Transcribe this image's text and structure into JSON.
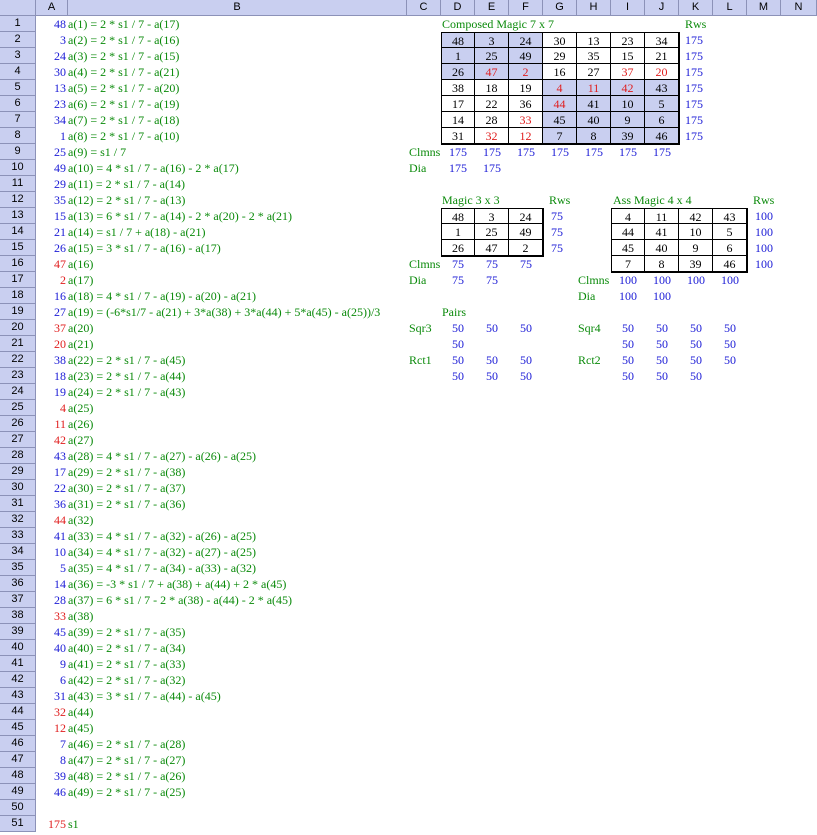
{
  "columns": [
    "A",
    "B",
    "C",
    "D",
    "E",
    "F",
    "G",
    "H",
    "I",
    "J",
    "K",
    "L",
    "M",
    "N"
  ],
  "rows": [
    "1",
    "2",
    "3",
    "4",
    "5",
    "6",
    "7",
    "8",
    "9",
    "10",
    "11",
    "12",
    "13",
    "14",
    "15",
    "16",
    "17",
    "18",
    "19",
    "20",
    "21",
    "22",
    "23",
    "24",
    "25",
    "26",
    "27",
    "28",
    "29",
    "30",
    "31",
    "32",
    "33",
    "34",
    "35",
    "36",
    "37",
    "38",
    "39",
    "40",
    "41",
    "42",
    "43",
    "44",
    "45",
    "46",
    "47",
    "48",
    "49",
    "50",
    "51"
  ],
  "colA": [
    {
      "v": "48",
      "c": "blue"
    },
    {
      "v": "3",
      "c": "blue"
    },
    {
      "v": "24",
      "c": "blue"
    },
    {
      "v": "30",
      "c": "blue"
    },
    {
      "v": "13",
      "c": "blue"
    },
    {
      "v": "23",
      "c": "blue"
    },
    {
      "v": "34",
      "c": "blue"
    },
    {
      "v": "1",
      "c": "blue"
    },
    {
      "v": "25",
      "c": "blue"
    },
    {
      "v": "49",
      "c": "blue"
    },
    {
      "v": "29",
      "c": "blue"
    },
    {
      "v": "35",
      "c": "blue"
    },
    {
      "v": "15",
      "c": "blue"
    },
    {
      "v": "21",
      "c": "blue"
    },
    {
      "v": "26",
      "c": "blue"
    },
    {
      "v": "47",
      "c": "red"
    },
    {
      "v": "2",
      "c": "red"
    },
    {
      "v": "16",
      "c": "blue"
    },
    {
      "v": "27",
      "c": "blue"
    },
    {
      "v": "37",
      "c": "red"
    },
    {
      "v": "20",
      "c": "red"
    },
    {
      "v": "38",
      "c": "blue"
    },
    {
      "v": "18",
      "c": "blue"
    },
    {
      "v": "19",
      "c": "blue"
    },
    {
      "v": "4",
      "c": "red"
    },
    {
      "v": "11",
      "c": "red"
    },
    {
      "v": "42",
      "c": "red"
    },
    {
      "v": "43",
      "c": "blue"
    },
    {
      "v": "17",
      "c": "blue"
    },
    {
      "v": "22",
      "c": "blue"
    },
    {
      "v": "36",
      "c": "blue"
    },
    {
      "v": "44",
      "c": "red"
    },
    {
      "v": "41",
      "c": "blue"
    },
    {
      "v": "10",
      "c": "blue"
    },
    {
      "v": "5",
      "c": "blue"
    },
    {
      "v": "14",
      "c": "blue"
    },
    {
      "v": "28",
      "c": "blue"
    },
    {
      "v": "33",
      "c": "red"
    },
    {
      "v": "45",
      "c": "blue"
    },
    {
      "v": "40",
      "c": "blue"
    },
    {
      "v": "9",
      "c": "blue"
    },
    {
      "v": "6",
      "c": "blue"
    },
    {
      "v": "31",
      "c": "blue"
    },
    {
      "v": "32",
      "c": "red"
    },
    {
      "v": "12",
      "c": "red"
    },
    {
      "v": "7",
      "c": "blue"
    },
    {
      "v": "8",
      "c": "blue"
    },
    {
      "v": "39",
      "c": "blue"
    },
    {
      "v": "46",
      "c": "blue"
    },
    {
      "v": "",
      "c": "blue"
    },
    {
      "v": "175",
      "c": "red"
    }
  ],
  "colB": [
    "a(1) = 2 * s1 / 7 - a(17)",
    "a(2) = 2 * s1 / 7 - a(16)",
    "a(3) = 2 * s1 / 7 - a(15)",
    "a(4) = 2 * s1 / 7 - a(21)",
    "a(5) = 2 * s1 / 7 - a(20)",
    "a(6) = 2 * s1 / 7 - a(19)",
    "a(7) = 2 * s1 / 7 - a(18)",
    "a(8) = 2 * s1 / 7 - a(10)",
    "a(9) = s1 / 7",
    "a(10) = 4 * s1 / 7 - a(16) - 2 * a(17)",
    "a(11) = 2 * s1 / 7 - a(14)",
    "a(12) = 2 * s1 / 7 - a(13)",
    "a(13) = 6 * s1 / 7 - a(14) - 2 * a(20) - 2 * a(21)",
    "a(14) = s1 / 7 + a(18) - a(21)",
    "a(15) = 3 * s1 / 7 - a(16) - a(17)",
    "a(16)",
    "a(17)",
    "a(18) = 4 * s1 / 7 - a(19) - a(20) - a(21)",
    "a(19) = (-6*s1/7 - a(21) + 3*a(38) + 3*a(44) + 5*a(45) - a(25))/3",
    "a(20)",
    "a(21)",
    "a(22) = 2 * s1 / 7 - a(45)",
    "a(23) = 2 * s1 / 7 - a(44)",
    "a(24) = 2 * s1 / 7 - a(43)",
    "a(25)",
    "a(26)",
    "a(27)",
    "a(28) = 4 * s1 / 7 - a(27) - a(26) - a(25)",
    "a(29) = 2 * s1 / 7 - a(38)",
    "a(30) = 2 * s1 / 7 - a(37)",
    "a(31) = 2 * s1 / 7 - a(36)",
    "a(32)",
    "a(33) = 4 * s1 / 7 - a(32) - a(26) - a(25)",
    "a(34) = 4 * s1 / 7 - a(32) - a(27) - a(25)",
    "a(35) = 4 * s1 / 7 - a(34) - a(33) - a(32)",
    "a(36) = -3 * s1 / 7 + a(38) + a(44) + 2 * a(45)",
    "a(37) = 6 * s1 / 7 - 2 * a(38) - a(44) - 2 * a(45)",
    "a(38)",
    "a(39) = 2 * s1 / 7 - a(35)",
    "a(40) = 2 * s1 / 7 - a(34)",
    "a(41) = 2 * s1 / 7 - a(33)",
    "a(42) = 2 * s1 / 7 - a(32)",
    "a(43) = 3 * s1 / 7 - a(44) - a(45)",
    "a(44)",
    "a(45)",
    "a(46) = 2 * s1 / 7 - a(28)",
    "a(47) = 2 * s1 / 7 - a(27)",
    "a(48) = 2 * s1 / 7 - a(26)",
    "a(49) = 2 * s1 / 7 - a(25)",
    "",
    "s1"
  ],
  "magic7": {
    "title": "Composed Magic 7 x 7",
    "rws_label": "Rws",
    "grid": [
      [
        {
          "v": "48",
          "c": "blk",
          "s": 1
        },
        {
          "v": "3",
          "c": "blk",
          "s": 1
        },
        {
          "v": "24",
          "c": "blk",
          "s": 1
        },
        {
          "v": "30",
          "c": "blk",
          "s": 0
        },
        {
          "v": "13",
          "c": "blk",
          "s": 0
        },
        {
          "v": "23",
          "c": "blk",
          "s": 0
        },
        {
          "v": "34",
          "c": "blk",
          "s": 0
        }
      ],
      [
        {
          "v": "1",
          "c": "blk",
          "s": 1
        },
        {
          "v": "25",
          "c": "blk",
          "s": 1
        },
        {
          "v": "49",
          "c": "blk",
          "s": 1
        },
        {
          "v": "29",
          "c": "blk",
          "s": 0
        },
        {
          "v": "35",
          "c": "blk",
          "s": 0
        },
        {
          "v": "15",
          "c": "blk",
          "s": 0
        },
        {
          "v": "21",
          "c": "blk",
          "s": 0
        }
      ],
      [
        {
          "v": "26",
          "c": "blk",
          "s": 1
        },
        {
          "v": "47",
          "c": "red",
          "s": 1
        },
        {
          "v": "2",
          "c": "red",
          "s": 1
        },
        {
          "v": "16",
          "c": "blk",
          "s": 0
        },
        {
          "v": "27",
          "c": "blk",
          "s": 0
        },
        {
          "v": "37",
          "c": "red",
          "s": 0
        },
        {
          "v": "20",
          "c": "red",
          "s": 0
        }
      ],
      [
        {
          "v": "38",
          "c": "blk",
          "s": 0
        },
        {
          "v": "18",
          "c": "blk",
          "s": 0
        },
        {
          "v": "19",
          "c": "blk",
          "s": 0
        },
        {
          "v": "4",
          "c": "red",
          "s": 1
        },
        {
          "v": "11",
          "c": "red",
          "s": 1
        },
        {
          "v": "42",
          "c": "red",
          "s": 1
        },
        {
          "v": "43",
          "c": "blk",
          "s": 1
        }
      ],
      [
        {
          "v": "17",
          "c": "blk",
          "s": 0
        },
        {
          "v": "22",
          "c": "blk",
          "s": 0
        },
        {
          "v": "36",
          "c": "blk",
          "s": 0
        },
        {
          "v": "44",
          "c": "red",
          "s": 1
        },
        {
          "v": "41",
          "c": "blk",
          "s": 1
        },
        {
          "v": "10",
          "c": "blk",
          "s": 1
        },
        {
          "v": "5",
          "c": "blk",
          "s": 1
        }
      ],
      [
        {
          "v": "14",
          "c": "blk",
          "s": 0
        },
        {
          "v": "28",
          "c": "blk",
          "s": 0
        },
        {
          "v": "33",
          "c": "red",
          "s": 0
        },
        {
          "v": "45",
          "c": "blk",
          "s": 1
        },
        {
          "v": "40",
          "c": "blk",
          "s": 1
        },
        {
          "v": "9",
          "c": "blk",
          "s": 1
        },
        {
          "v": "6",
          "c": "blk",
          "s": 1
        }
      ],
      [
        {
          "v": "31",
          "c": "blk",
          "s": 0
        },
        {
          "v": "32",
          "c": "red",
          "s": 0
        },
        {
          "v": "12",
          "c": "red",
          "s": 0
        },
        {
          "v": "7",
          "c": "blk",
          "s": 1
        },
        {
          "v": "8",
          "c": "blk",
          "s": 1
        },
        {
          "v": "39",
          "c": "blk",
          "s": 1
        },
        {
          "v": "46",
          "c": "blk",
          "s": 1
        }
      ]
    ],
    "rws": [
      "175",
      "175",
      "175",
      "175",
      "175",
      "175",
      "175"
    ],
    "clmns_label": "Clmns",
    "clmns": [
      "175",
      "175",
      "175",
      "175",
      "175",
      "175",
      "175"
    ],
    "dia_label": "Dia",
    "dia": [
      "175",
      "175"
    ]
  },
  "magic3": {
    "title": "Magic 3 x 3",
    "rws_label": "Rws",
    "grid": [
      [
        "48",
        "3",
        "24"
      ],
      [
        "1",
        "25",
        "49"
      ],
      [
        "26",
        "47",
        "2"
      ]
    ],
    "rws": [
      "75",
      "75",
      "75"
    ],
    "clmns_label": "Clmns",
    "clmns": [
      "75",
      "75",
      "75"
    ],
    "dia_label": "Dia",
    "dia": [
      "75",
      "75"
    ]
  },
  "magic4": {
    "title": "Ass Magic 4 x 4",
    "rws_label": "Rws",
    "grid": [
      [
        "4",
        "11",
        "42",
        "43"
      ],
      [
        "44",
        "41",
        "10",
        "5"
      ],
      [
        "45",
        "40",
        "9",
        "6"
      ],
      [
        "7",
        "8",
        "39",
        "46"
      ]
    ],
    "rws": [
      "100",
      "100",
      "100",
      "100"
    ],
    "clmns_label": "Clmns",
    "clmns": [
      "100",
      "100",
      "100",
      "100"
    ],
    "dia_label": "Dia",
    "dia": [
      "100",
      "100"
    ]
  },
  "pairs": {
    "title": "Pairs",
    "sqr3_label": "Sqr3",
    "sqr3": [
      [
        "50",
        "50",
        "50"
      ],
      [
        "50",
        "",
        ""
      ]
    ],
    "rct1_label": "Rct1",
    "rct1": [
      [
        "50",
        "50",
        "50"
      ],
      [
        "50",
        "50",
        "50"
      ]
    ],
    "sqr4_label": "Sqr4",
    "sqr4": [
      [
        "50",
        "50",
        "50",
        "50"
      ],
      [
        "50",
        "50",
        "50",
        "50"
      ]
    ],
    "rct2_label": "Rct2",
    "rct2": [
      [
        "50",
        "50",
        "50",
        "50"
      ],
      [
        "50",
        "50",
        "50"
      ]
    ]
  },
  "colors": {
    "header_bg": "#c9cff0",
    "blue": "#1b1bd6",
    "red": "#e01e1e",
    "green": "#0a8a0a"
  }
}
